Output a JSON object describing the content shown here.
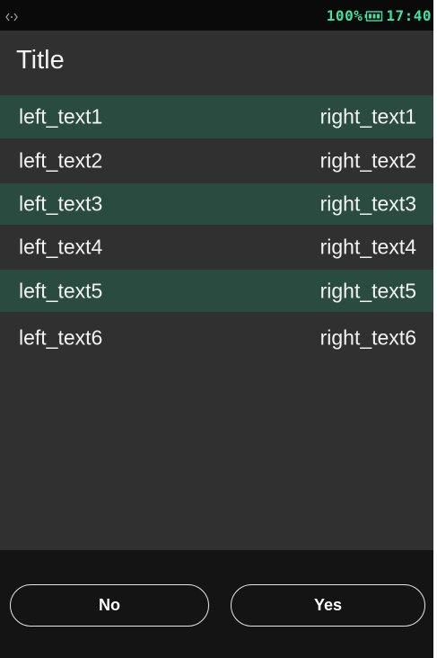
{
  "status_bar": {
    "left_icon": "code-brackets-icon",
    "battery_percent": "100%",
    "battery_icon": "battery-icon",
    "time": "17:40",
    "accent_color": "#3fe0a3"
  },
  "title": "Title",
  "list": {
    "highlight_color": "#2a4c40",
    "rows": [
      {
        "left": "left_text1",
        "right": "right_text1",
        "highlighted": true
      },
      {
        "left": "left_text2",
        "right": "right_text2",
        "highlighted": false
      },
      {
        "left": "left_text3",
        "right": "right_text3",
        "highlighted": true
      },
      {
        "left": "left_text4",
        "right": "right_text4",
        "highlighted": false
      },
      {
        "left": "left_text5",
        "right": "right_text5",
        "highlighted": true
      },
      {
        "left": "left_text6",
        "right": "right_text6",
        "highlighted": false
      }
    ]
  },
  "buttons": {
    "no_label": "No",
    "yes_label": "Yes"
  }
}
